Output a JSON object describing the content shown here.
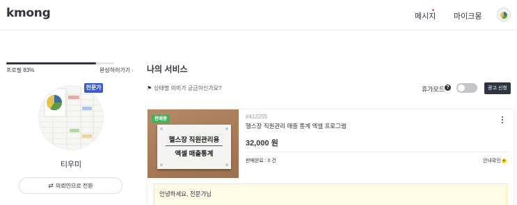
{
  "header": {
    "logo": "kmong",
    "nav": {
      "messages": "메시지",
      "my_kmong": "마이크몽"
    }
  },
  "profile": {
    "progress_percent": 83,
    "progress_label": "프로필 83%",
    "complete_link": "완성하러가기",
    "expert_badge": "전문가",
    "username": "티우미",
    "switch_button": "의뢰인으로 전환"
  },
  "main": {
    "title": "나의 서비스",
    "status_help": "상태별 의미가 궁금하신가요?",
    "vacation_mode": "휴가모드",
    "vacation_enabled": false,
    "ad_button": "광고 신청"
  },
  "service": {
    "badge": "판매중",
    "thumb_line1": "헬스장 직원관리용",
    "thumb_line2": "엑셀 매출통계",
    "id": "#412255",
    "title": "헬스장 직원관리 매출 통계 엑셀 프로그램",
    "price": "32,000 원",
    "sold": "판매완료 : 0 건",
    "guide": "안내확인",
    "notice": "안녕하세요, 전문가님"
  },
  "colors": {
    "primary_text": "#303441",
    "expert_badge": "#3b5bdb",
    "sale_badge": "#41b15a",
    "notice_bg": "#fffbe5",
    "ad_button": "#303441"
  },
  "icons": [
    "kebab-menu-icon",
    "flag-icon",
    "help-icon",
    "switch-arrows-icon",
    "chevron-right-icon",
    "notification-dot"
  ]
}
